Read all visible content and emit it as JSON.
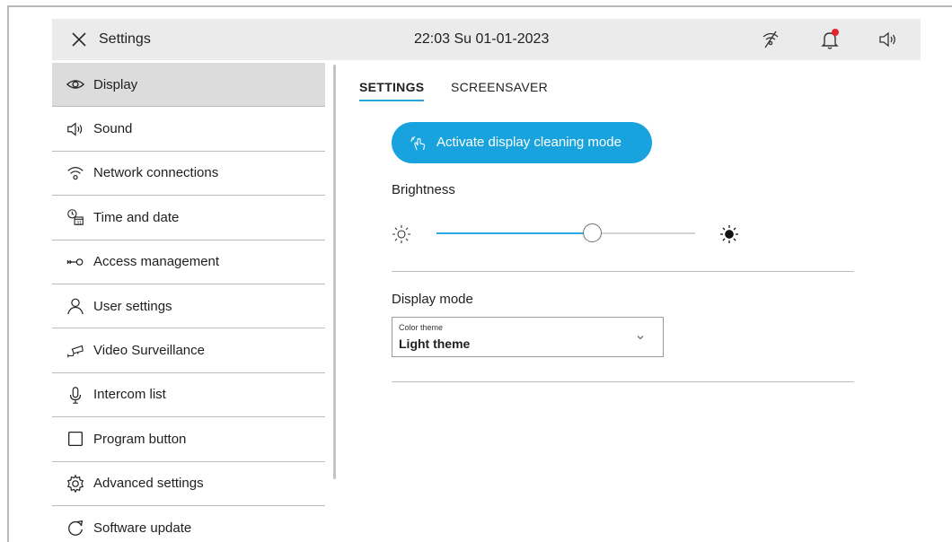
{
  "header": {
    "close_icon": "close-icon",
    "title": "Settings",
    "datetime": "22:03  Su 01-01-2023",
    "status_icons": [
      "no-connection-icon",
      "bell-icon",
      "speaker-icon"
    ],
    "notification_dot_color": "#e3262e"
  },
  "sidebar": {
    "items": [
      {
        "label": "Display",
        "icon": "eye-icon",
        "active": true
      },
      {
        "label": "Sound",
        "icon": "speaker-icon"
      },
      {
        "label": "Network connections",
        "icon": "wifi-icon"
      },
      {
        "label": "Time and date",
        "icon": "clock-calendar-icon"
      },
      {
        "label": "Access  management",
        "icon": "key-icon"
      },
      {
        "label": "User settings",
        "icon": "user-icon"
      },
      {
        "label": "Video Surveillance",
        "icon": "camera-icon"
      },
      {
        "label": "Intercom list",
        "icon": "microphone-icon"
      },
      {
        "label": "Program button",
        "icon": "square-icon"
      },
      {
        "label": "Advanced settings",
        "icon": "gear-icon"
      },
      {
        "label": "Software update",
        "icon": "refresh-icon"
      }
    ]
  },
  "tabs": [
    {
      "label": "SETTINGS",
      "active": true
    },
    {
      "label": "SCREENSAVER",
      "active": false
    }
  ],
  "main": {
    "cleaning_button_label": "Activate display cleaning mode",
    "cleaning_button_icon": "hand-swipe-icon",
    "brightness_label": "Brightness",
    "brightness_level": 0.6,
    "brightness_low_icon": "sun-outline-icon",
    "brightness_high_icon": "sun-filled-icon",
    "display_mode_label": "Display mode",
    "color_theme": {
      "caption": "Color theme",
      "value": "Light theme"
    }
  },
  "colors": {
    "accent": "#18a3de",
    "header_bg": "#ebebeb",
    "active_item_bg": "#dcdcdc",
    "divider": "#bdbdbd"
  }
}
